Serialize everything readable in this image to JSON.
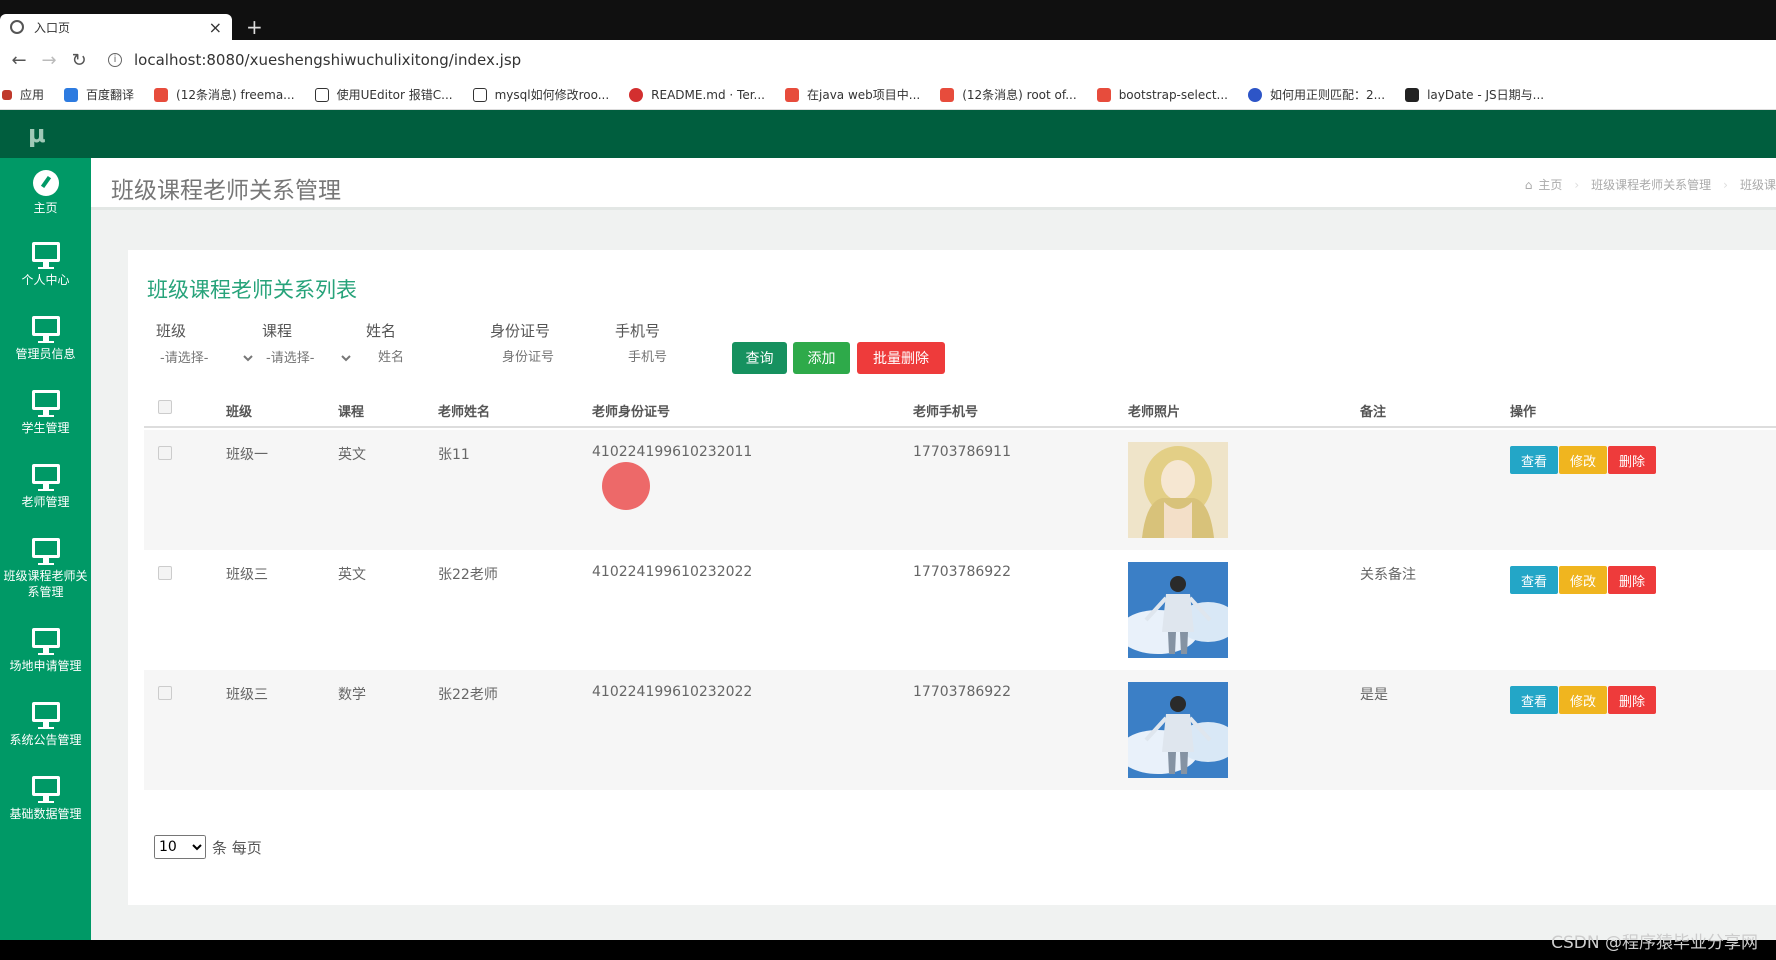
{
  "browser": {
    "tab_title": "入口页",
    "url": "localhost:8080/xueshengshiwuchulixitong/index.jsp",
    "bookmarks": [
      {
        "label": "应用",
        "color": "#c0392b"
      },
      {
        "label": "百度翻译",
        "color": "#2d7be0"
      },
      {
        "label": "(12条消息) freema...",
        "color": "#e74c3c"
      },
      {
        "label": "使用UEditor 报错C...",
        "color": "#333333"
      },
      {
        "label": "mysql如何修改roo...",
        "color": "#333333"
      },
      {
        "label": "README.md · Ter...",
        "color": "#d32f2f"
      },
      {
        "label": "在java web项目中...",
        "color": "#e74c3c"
      },
      {
        "label": "(12条消息) root of...",
        "color": "#e74c3c"
      },
      {
        "label": "bootstrap-select...",
        "color": "#e74c3c"
      },
      {
        "label": "如何用正则匹配：2...",
        "color": "#2d55c7"
      },
      {
        "label": "layDate - JS日期与...",
        "color": "#222222"
      }
    ]
  },
  "app": {
    "logo": "μ",
    "colors": {
      "topbar": "#005e3e",
      "sidebar": "#009966",
      "accent": "#27a37a"
    }
  },
  "sidebar": {
    "items": [
      {
        "label": "主页",
        "icon": "dashboard-icon"
      },
      {
        "label": "个人中心",
        "icon": "monitor-icon"
      },
      {
        "label": "管理员信息",
        "icon": "monitor-icon"
      },
      {
        "label": "学生管理",
        "icon": "monitor-icon"
      },
      {
        "label": "老师管理",
        "icon": "monitor-icon"
      },
      {
        "label": "班级课程老师关系管理",
        "icon": "monitor-icon"
      },
      {
        "label": "场地申请管理",
        "icon": "monitor-icon"
      },
      {
        "label": "系统公告管理",
        "icon": "monitor-icon"
      },
      {
        "label": "基础数据管理",
        "icon": "monitor-icon"
      }
    ]
  },
  "page": {
    "title": "班级课程老师关系管理",
    "breadcrumb": {
      "home": "主页",
      "current": "班级课程老师关系管理",
      "extra": "班级课"
    }
  },
  "card": {
    "title": "班级课程老师关系列表"
  },
  "filters": {
    "class_label": "班级",
    "course_label": "课程",
    "name_label": "姓名",
    "id_label": "身份证号",
    "phone_label": "手机号",
    "class_select": "-请选择-",
    "course_select": "-请选择-",
    "name_placeholder": "姓名",
    "id_placeholder": "身份证号",
    "phone_placeholder": "手机号",
    "search_button": "查询",
    "add_button": "添加",
    "batch_delete_button": "批量删除"
  },
  "table": {
    "headers": {
      "class": "班级",
      "course": "课程",
      "teacher_name": "老师姓名",
      "teacher_id": "老师身份证号",
      "teacher_phone": "老师手机号",
      "teacher_photo": "老师照片",
      "remark": "备注",
      "actions": "操作"
    },
    "rows": [
      {
        "class": "班级一",
        "course": "英文",
        "teacher_name": "张11",
        "teacher_id": "410224199610232011",
        "teacher_phone": "17703786911",
        "remark": "",
        "photo": "anime-girl-photo"
      },
      {
        "class": "班级三",
        "course": "英文",
        "teacher_name": "张22老师",
        "teacher_id": "410224199610232022",
        "teacher_phone": "17703786922",
        "remark": "关系备注",
        "photo": "boy-sky-photo"
      },
      {
        "class": "班级三",
        "course": "数学",
        "teacher_name": "张22老师",
        "teacher_id": "410224199610232022",
        "teacher_phone": "17703786922",
        "remark": "是是",
        "photo": "boy-sky-photo"
      }
    ],
    "actions": {
      "view": "查看",
      "edit": "修改",
      "delete": "删除"
    }
  },
  "pager": {
    "page_size": "10",
    "suffix": "条 每页"
  },
  "watermark": "CSDN @程序猿毕业分享网"
}
